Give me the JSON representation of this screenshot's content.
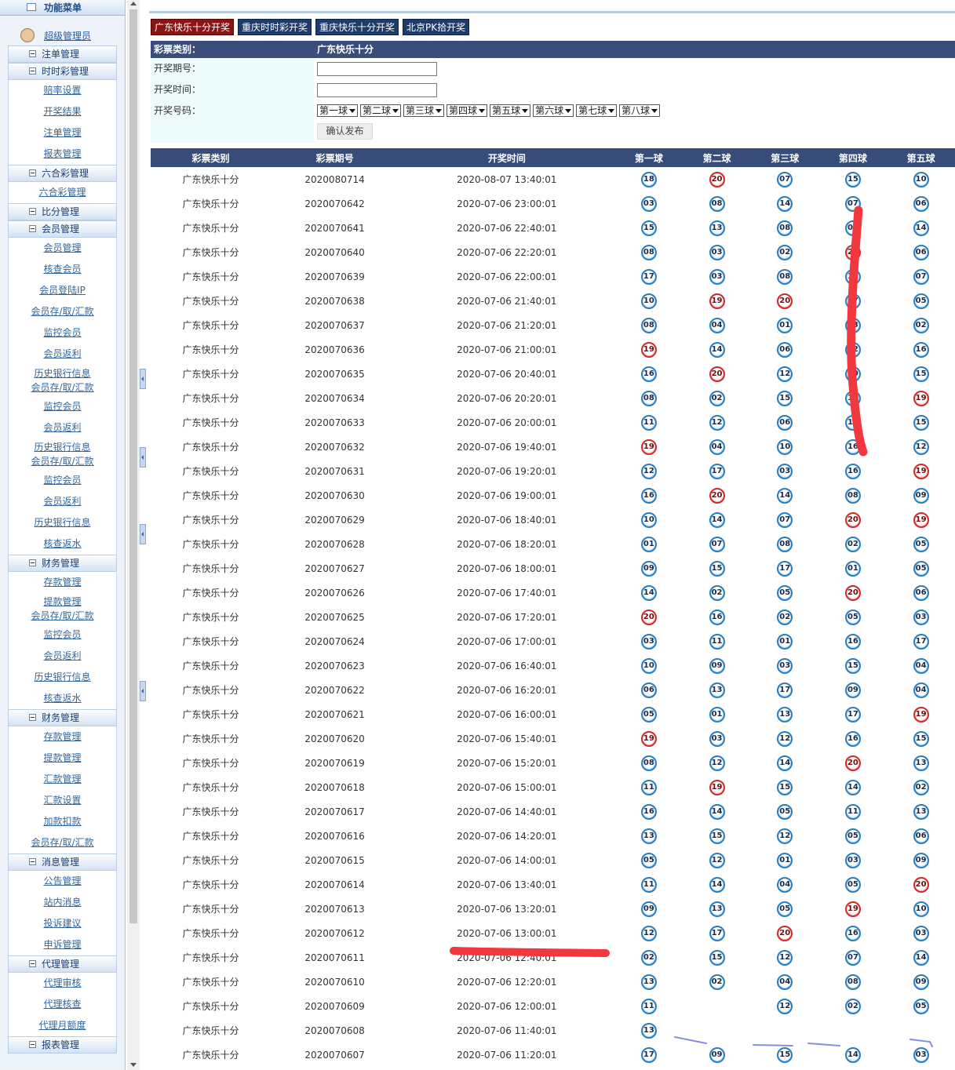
{
  "sidebar": {
    "title": "功能菜单",
    "user": "超级管理员",
    "entries": [
      {
        "type": "section",
        "label": "注单管理"
      },
      {
        "type": "section",
        "label": "时时彩管理"
      },
      {
        "type": "item",
        "label": "赔率设置"
      },
      {
        "type": "item",
        "label": "开奖结果"
      },
      {
        "type": "item",
        "label": "注单管理"
      },
      {
        "type": "item",
        "label": "报表管理"
      },
      {
        "type": "section",
        "label": "六合彩管理"
      },
      {
        "type": "item",
        "label": "六合彩管理"
      },
      {
        "type": "section",
        "label": "比分管理"
      },
      {
        "type": "section",
        "label": "会员管理"
      },
      {
        "type": "item",
        "label": "会员管理"
      },
      {
        "type": "item",
        "label": "核查会员"
      },
      {
        "type": "item",
        "label": "会员登陆IP"
      },
      {
        "type": "item",
        "label": "会员存/取/汇款"
      },
      {
        "type": "item",
        "label": "监控会员"
      },
      {
        "type": "item",
        "label": "会员返利"
      },
      {
        "type": "item2",
        "label": "历史银行信息",
        "label2": "会员存/取/汇款"
      },
      {
        "type": "item",
        "label": "监控会员"
      },
      {
        "type": "item",
        "label": "会员返利"
      },
      {
        "type": "item2",
        "label": "历史银行信息",
        "label2": "会员存/取/汇款"
      },
      {
        "type": "item",
        "label": "监控会员"
      },
      {
        "type": "item",
        "label": "会员返利"
      },
      {
        "type": "item",
        "label": "历史银行信息"
      },
      {
        "type": "item",
        "label": "核查返水"
      },
      {
        "type": "section",
        "label": "财务管理"
      },
      {
        "type": "item",
        "label": "存款管理"
      },
      {
        "type": "item2",
        "label": "提款管理",
        "label2": "会员存/取/汇款"
      },
      {
        "type": "item",
        "label": "监控会员"
      },
      {
        "type": "item",
        "label": "会员返利"
      },
      {
        "type": "item",
        "label": "历史银行信息"
      },
      {
        "type": "item",
        "label": "核查返水"
      },
      {
        "type": "section",
        "label": "财务管理"
      },
      {
        "type": "item",
        "label": "存款管理"
      },
      {
        "type": "item",
        "label": "提款管理"
      },
      {
        "type": "item",
        "label": "汇款管理"
      },
      {
        "type": "item",
        "label": "汇款设置"
      },
      {
        "type": "item",
        "label": "加款扣款"
      },
      {
        "type": "item",
        "label": "会员存/取/汇款"
      },
      {
        "type": "section",
        "label": "消息管理"
      },
      {
        "type": "item",
        "label": "公告管理"
      },
      {
        "type": "item",
        "label": "站内消息"
      },
      {
        "type": "item",
        "label": "投诉建议"
      },
      {
        "type": "item",
        "label": "申诉管理"
      },
      {
        "type": "section",
        "label": "代理管理"
      },
      {
        "type": "item",
        "label": "代理审核"
      },
      {
        "type": "item",
        "label": "代理核查"
      },
      {
        "type": "item",
        "label": "代理月额度"
      },
      {
        "type": "section",
        "label": "报表管理"
      }
    ]
  },
  "tabs": [
    "广东快乐十分开奖",
    "重庆时时彩开奖",
    "重庆快乐十分开奖",
    "北京PK拾开奖"
  ],
  "form": {
    "type_label": "彩票类别：",
    "type_value": "广东快乐十分",
    "period_label": "开奖期号：",
    "time_label": "开奖时间：",
    "number_label": "开奖号码：",
    "selects": [
      "第一球",
      "第二球",
      "第三球",
      "第四球",
      "第五球",
      "第六球",
      "第七球",
      "第八球"
    ],
    "submit_label": "确认发布"
  },
  "table": {
    "headers": [
      "彩票类别",
      "彩票期号",
      "开奖时间",
      "第一球",
      "第二球",
      "第三球",
      "第四球",
      "第五球"
    ],
    "red_numbers": [
      "19",
      "20"
    ],
    "rows": [
      {
        "type": "广东快乐十分",
        "period": "2020080714",
        "time": "2020-08-07 13:40:01",
        "balls": [
          "18",
          "20",
          "07",
          "15",
          "10"
        ]
      },
      {
        "type": "广东快乐十分",
        "period": "2020070642",
        "time": "2020-07-06 23:00:01",
        "balls": [
          "03",
          "08",
          "14",
          "07",
          "06"
        ]
      },
      {
        "type": "广东快乐十分",
        "period": "2020070641",
        "time": "2020-07-06 22:40:01",
        "balls": [
          "15",
          "13",
          "08",
          "02",
          "14"
        ]
      },
      {
        "type": "广东快乐十分",
        "period": "2020070640",
        "time": "2020-07-06 22:20:01",
        "balls": [
          "08",
          "03",
          "02",
          "20",
          "06"
        ]
      },
      {
        "type": "广东快乐十分",
        "period": "2020070639",
        "time": "2020-07-06 22:00:01",
        "balls": [
          "17",
          "03",
          "08",
          "14",
          "07"
        ]
      },
      {
        "type": "广东快乐十分",
        "period": "2020070638",
        "time": "2020-07-06 21:40:01",
        "balls": [
          "10",
          "19",
          "20",
          "17",
          "05"
        ]
      },
      {
        "type": "广东快乐十分",
        "period": "2020070637",
        "time": "2020-07-06 21:20:01",
        "balls": [
          "08",
          "04",
          "01",
          "13",
          "02"
        ]
      },
      {
        "type": "广东快乐十分",
        "period": "2020070636",
        "time": "2020-07-06 21:00:01",
        "balls": [
          "19",
          "14",
          "06",
          "12",
          "16"
        ]
      },
      {
        "type": "广东快乐十分",
        "period": "2020070635",
        "time": "2020-07-06 20:40:01",
        "balls": [
          "16",
          "20",
          "12",
          "10",
          "15"
        ]
      },
      {
        "type": "广东快乐十分",
        "period": "2020070634",
        "time": "2020-07-06 20:20:01",
        "balls": [
          "08",
          "02",
          "15",
          "10",
          "19"
        ]
      },
      {
        "type": "广东快乐十分",
        "period": "2020070633",
        "time": "2020-07-06 20:00:01",
        "balls": [
          "11",
          "12",
          "06",
          "14",
          "15"
        ]
      },
      {
        "type": "广东快乐十分",
        "period": "2020070632",
        "time": "2020-07-06 19:40:01",
        "balls": [
          "19",
          "04",
          "10",
          "16",
          "12"
        ]
      },
      {
        "type": "广东快乐十分",
        "period": "2020070631",
        "time": "2020-07-06 19:20:01",
        "balls": [
          "12",
          "17",
          "03",
          "16",
          "19"
        ]
      },
      {
        "type": "广东快乐十分",
        "period": "2020070630",
        "time": "2020-07-06 19:00:01",
        "balls": [
          "16",
          "20",
          "14",
          "08",
          "09"
        ]
      },
      {
        "type": "广东快乐十分",
        "period": "2020070629",
        "time": "2020-07-06 18:40:01",
        "balls": [
          "10",
          "14",
          "07",
          "20",
          "19"
        ]
      },
      {
        "type": "广东快乐十分",
        "period": "2020070628",
        "time": "2020-07-06 18:20:01",
        "balls": [
          "01",
          "07",
          "08",
          "02",
          "05"
        ]
      },
      {
        "type": "广东快乐十分",
        "period": "2020070627",
        "time": "2020-07-06 18:00:01",
        "balls": [
          "09",
          "15",
          "17",
          "01",
          "05"
        ]
      },
      {
        "type": "广东快乐十分",
        "period": "2020070626",
        "time": "2020-07-06 17:40:01",
        "balls": [
          "14",
          "02",
          "05",
          "20",
          "06"
        ]
      },
      {
        "type": "广东快乐十分",
        "period": "2020070625",
        "time": "2020-07-06 17:20:01",
        "balls": [
          "20",
          "16",
          "02",
          "05",
          "03"
        ]
      },
      {
        "type": "广东快乐十分",
        "period": "2020070624",
        "time": "2020-07-06 17:00:01",
        "balls": [
          "03",
          "11",
          "01",
          "16",
          "17"
        ]
      },
      {
        "type": "广东快乐十分",
        "period": "2020070623",
        "time": "2020-07-06 16:40:01",
        "balls": [
          "10",
          "09",
          "03",
          "15",
          "04"
        ]
      },
      {
        "type": "广东快乐十分",
        "period": "2020070622",
        "time": "2020-07-06 16:20:01",
        "balls": [
          "06",
          "13",
          "17",
          "09",
          "04"
        ]
      },
      {
        "type": "广东快乐十分",
        "period": "2020070621",
        "time": "2020-07-06 16:00:01",
        "balls": [
          "05",
          "01",
          "13",
          "17",
          "19"
        ]
      },
      {
        "type": "广东快乐十分",
        "period": "2020070620",
        "time": "2020-07-06 15:40:01",
        "balls": [
          "19",
          "03",
          "12",
          "16",
          "15"
        ]
      },
      {
        "type": "广东快乐十分",
        "period": "2020070619",
        "time": "2020-07-06 15:20:01",
        "balls": [
          "08",
          "12",
          "14",
          "20",
          "13"
        ]
      },
      {
        "type": "广东快乐十分",
        "period": "2020070618",
        "time": "2020-07-06 15:00:01",
        "balls": [
          "11",
          "19",
          "15",
          "14",
          "02"
        ]
      },
      {
        "type": "广东快乐十分",
        "period": "2020070617",
        "time": "2020-07-06 14:40:01",
        "balls": [
          "16",
          "14",
          "05",
          "11",
          "13"
        ]
      },
      {
        "type": "广东快乐十分",
        "period": "2020070616",
        "time": "2020-07-06 14:20:01",
        "balls": [
          "13",
          "15",
          "12",
          "05",
          "06"
        ]
      },
      {
        "type": "广东快乐十分",
        "period": "2020070615",
        "time": "2020-07-06 14:00:01",
        "balls": [
          "05",
          "12",
          "01",
          "03",
          "09"
        ]
      },
      {
        "type": "广东快乐十分",
        "period": "2020070614",
        "time": "2020-07-06 13:40:01",
        "balls": [
          "11",
          "14",
          "04",
          "05",
          "20"
        ]
      },
      {
        "type": "广东快乐十分",
        "period": "2020070613",
        "time": "2020-07-06 13:20:01",
        "balls": [
          "09",
          "13",
          "05",
          "19",
          "10"
        ]
      },
      {
        "type": "广东快乐十分",
        "period": "2020070612",
        "time": "2020-07-06 13:00:01",
        "balls": [
          "12",
          "17",
          "20",
          "16",
          "03"
        ]
      },
      {
        "type": "广东快乐十分",
        "period": "2020070611",
        "time": "2020-07-06 12:40:01",
        "balls": [
          "02",
          "15",
          "12",
          "07",
          "14"
        ]
      },
      {
        "type": "广东快乐十分",
        "period": "2020070610",
        "time": "2020-07-06 12:20:01",
        "balls": [
          "13",
          "02",
          "04",
          "08",
          "09"
        ]
      },
      {
        "type": "广东快乐十分",
        "period": "2020070609",
        "time": "2020-07-06 12:00:01",
        "balls": [
          "11",
          "",
          "12",
          "02",
          "05"
        ]
      },
      {
        "type": "广东快乐十分",
        "period": "2020070608",
        "time": "2020-07-06 11:40:01",
        "balls": [
          "13",
          "",
          "",
          "",
          ""
        ]
      },
      {
        "type": "广东快乐十分",
        "period": "2020070607",
        "time": "2020-07-06 11:20:01",
        "balls": [
          "17",
          "09",
          "15",
          "14",
          "03"
        ]
      }
    ]
  },
  "annotation_colors": {
    "red_marker": "#f0383e",
    "blue_marker": "#3344cc"
  }
}
